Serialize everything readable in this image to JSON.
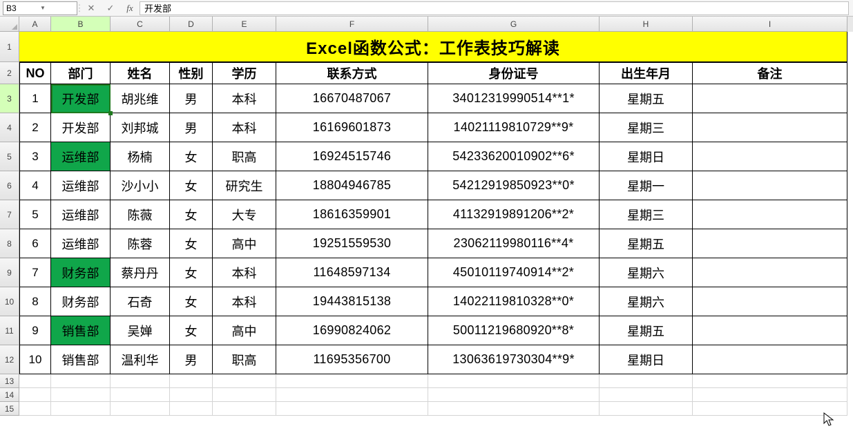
{
  "namebox": "B3",
  "formula_value": "开发部",
  "columns": [
    "A",
    "B",
    "C",
    "D",
    "E",
    "F",
    "G",
    "H",
    "I"
  ],
  "selected_col": "B",
  "selected_row": 3,
  "title": "Excel函数公式：工作表技巧解读",
  "headers": {
    "no": "NO",
    "dept": "部门",
    "name": "姓名",
    "gender": "性别",
    "edu": "学历",
    "contact": "联系方式",
    "idnum": "身份证号",
    "birth": "出生年月",
    "remark": "备注"
  },
  "rows": [
    {
      "no": "1",
      "dept": "开发部",
      "name": "胡兆维",
      "gender": "男",
      "edu": "本科",
      "contact": "16670487067",
      "idnum": "34012319990514**1*",
      "birth": "星期五",
      "remark": "",
      "dept_green": true
    },
    {
      "no": "2",
      "dept": "开发部",
      "name": "刘邦城",
      "gender": "男",
      "edu": "本科",
      "contact": "16169601873",
      "idnum": "14021119810729**9*",
      "birth": "星期三",
      "remark": "",
      "dept_green": false
    },
    {
      "no": "3",
      "dept": "运维部",
      "name": "杨楠",
      "gender": "女",
      "edu": "职高",
      "contact": "16924515746",
      "idnum": "54233620010902**6*",
      "birth": "星期日",
      "remark": "",
      "dept_green": true
    },
    {
      "no": "4",
      "dept": "运维部",
      "name": "沙小小",
      "gender": "女",
      "edu": "研究生",
      "contact": "18804946785",
      "idnum": "54212919850923**0*",
      "birth": "星期一",
      "remark": "",
      "dept_green": false
    },
    {
      "no": "5",
      "dept": "运维部",
      "name": "陈薇",
      "gender": "女",
      "edu": "大专",
      "contact": "18616359901",
      "idnum": "41132919891206**2*",
      "birth": "星期三",
      "remark": "",
      "dept_green": false
    },
    {
      "no": "6",
      "dept": "运维部",
      "name": "陈蓉",
      "gender": "女",
      "edu": "高中",
      "contact": "19251559530",
      "idnum": "23062119980116**4*",
      "birth": "星期五",
      "remark": "",
      "dept_green": false
    },
    {
      "no": "7",
      "dept": "财务部",
      "name": "蔡丹丹",
      "gender": "女",
      "edu": "本科",
      "contact": "11648597134",
      "idnum": "45010119740914**2*",
      "birth": "星期六",
      "remark": "",
      "dept_green": true
    },
    {
      "no": "8",
      "dept": "财务部",
      "name": "石奇",
      "gender": "女",
      "edu": "本科",
      "contact": "19443815138",
      "idnum": "14022119810328**0*",
      "birth": "星期六",
      "remark": "",
      "dept_green": false
    },
    {
      "no": "9",
      "dept": "销售部",
      "name": "吴婵",
      "gender": "女",
      "edu": "高中",
      "contact": "16990824062",
      "idnum": "50011219680920**8*",
      "birth": "星期五",
      "remark": "",
      "dept_green": true
    },
    {
      "no": "10",
      "dept": "销售部",
      "name": "温利华",
      "gender": "男",
      "edu": "职高",
      "contact": "11695356700",
      "idnum": "13063619730304**9*",
      "birth": "星期日",
      "remark": "",
      "dept_green": false
    }
  ],
  "empty_rows": [
    13,
    14,
    15
  ]
}
